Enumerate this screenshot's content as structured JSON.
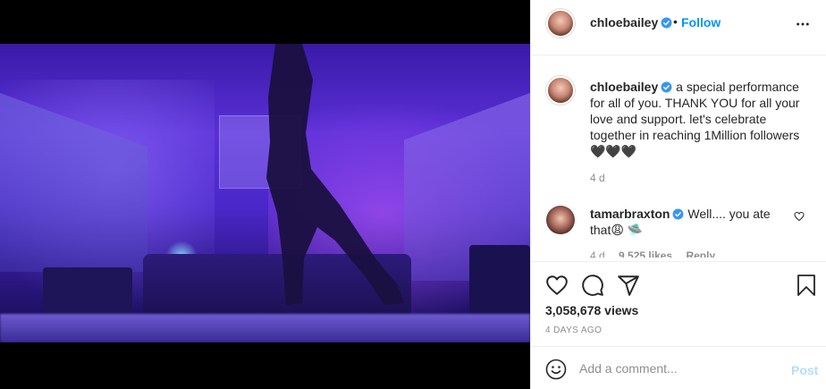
{
  "post": {
    "author": "chloebailey",
    "follow_label": "Follow",
    "separator": "•",
    "caption": "a special performance for all of you. THANK YOU for all your love and support. let's celebrate together in reaching 1Million followers 🖤🖤🖤",
    "caption_time": "4 d",
    "views": "3,058,678 views",
    "age": "4 DAYS AGO"
  },
  "comment": {
    "author": "tamarbraxton",
    "text": "Well.... you ate that😩 🛸",
    "time": "4 d",
    "likes": "9,525 likes",
    "reply_label": "Reply"
  },
  "add_comment": {
    "placeholder": "Add a comment...",
    "post_label": "Post"
  },
  "colors": {
    "accent": "#0095f6",
    "verified": "#3897f0",
    "post_disabled": "#b2dffc"
  },
  "icons": [
    "volume-icon",
    "verified-icon",
    "more-icon",
    "heart-icon",
    "comment-icon",
    "share-icon",
    "bookmark-icon",
    "emoji-icon"
  ]
}
